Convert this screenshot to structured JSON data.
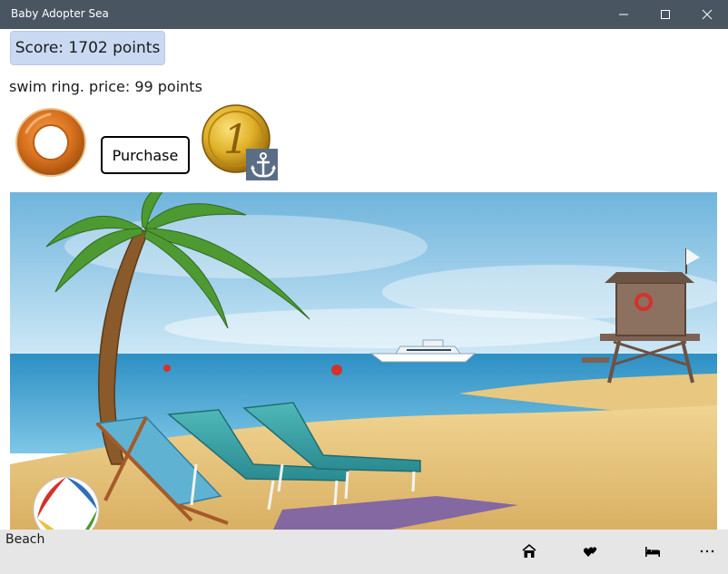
{
  "window": {
    "title": "Baby Adopter Sea",
    "controls": [
      "minimize-icon",
      "maximize-icon",
      "close-icon"
    ]
  },
  "score": {
    "text": "Score: 1702 points"
  },
  "item": {
    "description": "swim ring. price: 99 points",
    "icon": "swim-ring-icon",
    "purchase_label": "Purchase"
  },
  "currency": {
    "coin_icon": "gold-coin-icon",
    "badge_icon": "anchor-icon"
  },
  "scene": {
    "name": "beach-scene"
  },
  "appbar": {
    "page_label": "Beach",
    "buttons": [
      {
        "icon": "home-icon"
      },
      {
        "icon": "hearts-icon"
      },
      {
        "icon": "bed-icon"
      },
      {
        "icon": "more-icon"
      }
    ]
  },
  "colors": {
    "titlebar": "#4a5562",
    "score_badge": "#c9d9f2",
    "appbar": "#e6e6e6"
  }
}
